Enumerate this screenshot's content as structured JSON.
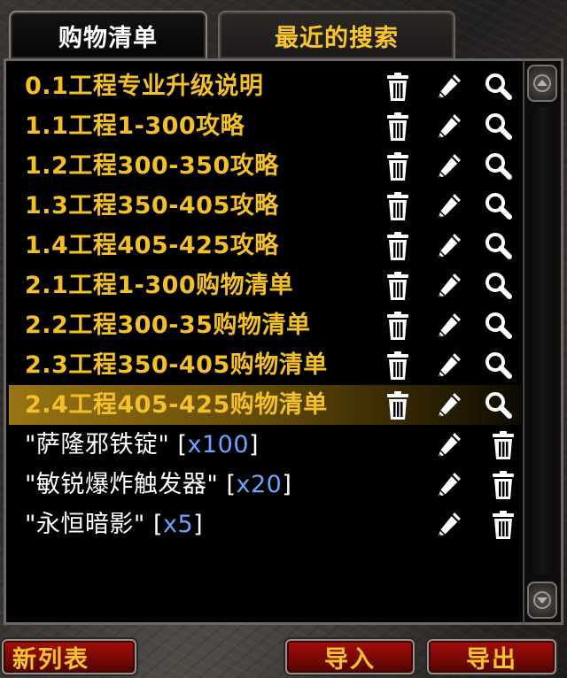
{
  "tabs": {
    "shopping_list": "购物清单",
    "recent_searches": "最近的搜索"
  },
  "lists": [
    {
      "label": "0.1工程专业升级说明"
    },
    {
      "label": "1.1工程1-300攻略"
    },
    {
      "label": "1.2工程300-350攻略"
    },
    {
      "label": "1.3工程350-405攻略"
    },
    {
      "label": "1.4工程405-425攻略"
    },
    {
      "label": "2.1工程1-300购物清单"
    },
    {
      "label": "2.2工程300-35购物清单"
    },
    {
      "label": "2.3工程350-405购物清单"
    },
    {
      "label": "2.4工程405-425购物清单",
      "selected": true
    }
  ],
  "items": [
    {
      "name": "\"萨隆邪铁锭\"",
      "open": "[",
      "qty": "x100",
      "close": "]"
    },
    {
      "name": "\"敏锐爆炸触发器\"",
      "open": "[",
      "qty": "x20",
      "close": "]"
    },
    {
      "name": "\"永恒暗影\"",
      "open": "[",
      "qty": "x5",
      "close": "]"
    }
  ],
  "icons": {
    "delete": "trash-icon",
    "edit": "pencil-icon",
    "search": "magnifier-icon",
    "scroll_up": "scroll-up-icon",
    "scroll_down": "scroll-down-icon"
  },
  "buttons": {
    "new_list": "新列表",
    "import": "导入",
    "export": "导出"
  },
  "colors": {
    "list_text": "#f4c027",
    "item_text": "#ffffff",
    "quantity_text": "#6aa4ff",
    "selected_row": "#a07a14",
    "button_bg": "#8a0c07",
    "button_text": "#f7c52b"
  }
}
